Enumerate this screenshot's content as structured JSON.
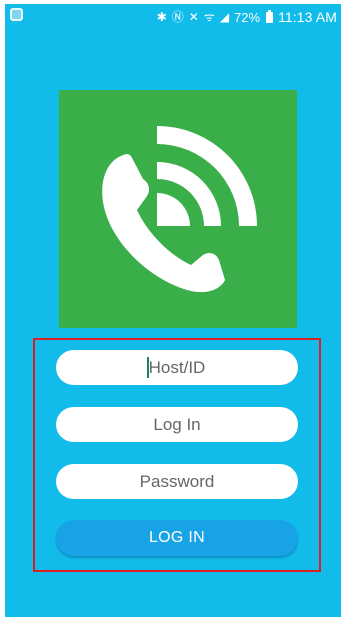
{
  "status_bar": {
    "icons": [
      "app-notification-icon",
      "bluetooth-icon",
      "nfc-icon",
      "mute-icon",
      "wifi-icon",
      "signal-icon"
    ],
    "battery_percent": "72%",
    "time": "11:13 AM"
  },
  "logo": {
    "icon": "phone-with-signal-waves-icon",
    "background_color": "#3aae49"
  },
  "form": {
    "host_placeholder": "Host/ID",
    "host_value": "",
    "login_placeholder": "Log In",
    "login_value": "",
    "password_placeholder": "Password",
    "password_value": "",
    "submit_label": "LOG IN"
  },
  "colors": {
    "background": "#12bcea",
    "button": "#18a3e6",
    "highlight_border": "#dc1f1f"
  }
}
